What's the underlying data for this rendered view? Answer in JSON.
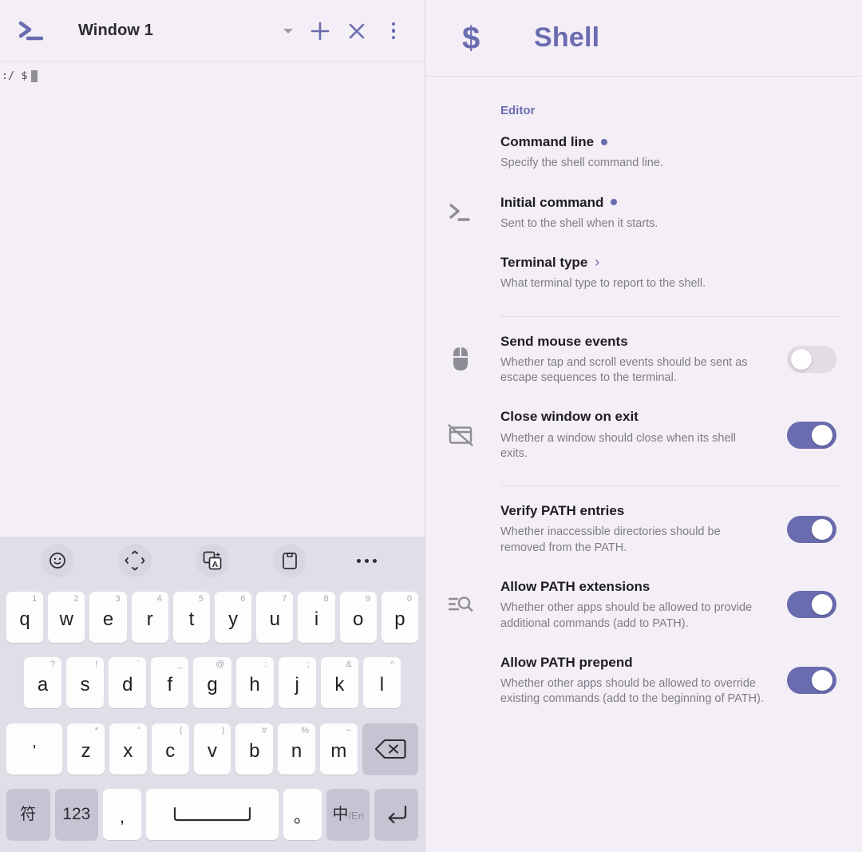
{
  "terminal": {
    "window_title": "Window 1",
    "logo_icon": "terminal-prompt-icon",
    "toolbar": {
      "dropdown_icon": "chevron-down-icon",
      "new_tab_icon": "plus-icon",
      "close_icon": "close-x-icon",
      "overflow_icon": "more-vertical-icon"
    },
    "prompt_line": ":/ $",
    "cursor": "block-cursor"
  },
  "keyboard": {
    "toolbar": [
      {
        "name": "emoji-icon",
        "glyph": "☺"
      },
      {
        "name": "cursor-move-icon",
        "glyph": "move"
      },
      {
        "name": "translate-icon",
        "glyph": "translate"
      },
      {
        "name": "clipboard-icon",
        "glyph": "clipboard"
      },
      {
        "name": "more-horizontal-icon",
        "glyph": "…"
      }
    ],
    "row1": [
      {
        "key": "q",
        "hint": "1"
      },
      {
        "key": "w",
        "hint": "2"
      },
      {
        "key": "e",
        "hint": "3"
      },
      {
        "key": "r",
        "hint": "4"
      },
      {
        "key": "t",
        "hint": "5"
      },
      {
        "key": "y",
        "hint": "6"
      },
      {
        "key": "u",
        "hint": "7"
      },
      {
        "key": "i",
        "hint": "8"
      },
      {
        "key": "o",
        "hint": "9"
      },
      {
        "key": "p",
        "hint": "0"
      }
    ],
    "row2": [
      {
        "key": "a",
        "hint": "?"
      },
      {
        "key": "s",
        "hint": "!"
      },
      {
        "key": "d",
        "hint": "`"
      },
      {
        "key": "f",
        "hint": "_"
      },
      {
        "key": "g",
        "hint": "@"
      },
      {
        "key": "h",
        "hint": ":"
      },
      {
        "key": "j",
        "hint": ";"
      },
      {
        "key": "k",
        "hint": "&"
      },
      {
        "key": "l",
        "hint": "^"
      }
    ],
    "row3": [
      {
        "key": "'",
        "hint": ""
      },
      {
        "key": "z",
        "hint": "*"
      },
      {
        "key": "x",
        "hint": "\""
      },
      {
        "key": "c",
        "hint": "("
      },
      {
        "key": "v",
        "hint": ")"
      },
      {
        "key": "b",
        "hint": "#"
      },
      {
        "key": "n",
        "hint": "%"
      },
      {
        "key": "m",
        "hint": "~"
      }
    ],
    "backspace_icon": "backspace-icon",
    "row4": {
      "symbols": "符",
      "numbers": "123",
      "comma": ",",
      "space": "space-bar",
      "period": "。",
      "lang_main": "中",
      "lang_sub": "/En",
      "enter_icon": "enter-return-icon"
    }
  },
  "settings": {
    "header_glyph": "$",
    "header_title": "Shell",
    "section_label": "Editor",
    "accent_color": "#6a6cb0",
    "items": [
      {
        "id": "command-line",
        "icon": "",
        "title": "Command line",
        "marker": "dot",
        "desc": "Specify the shell command line.",
        "control": "none"
      },
      {
        "id": "initial-command",
        "icon": "terminal-prompt-icon",
        "title": "Initial command",
        "marker": "dot",
        "desc": "Sent to the shell when it starts.",
        "control": "none"
      },
      {
        "id": "terminal-type",
        "icon": "",
        "title": "Terminal type",
        "marker": "chevron",
        "desc": "What terminal type to report to the shell.",
        "control": "none"
      },
      {
        "id": "send-mouse-events",
        "icon": "mouse-icon",
        "title": "Send mouse events",
        "marker": "",
        "desc": "Whether tap and scroll events should be sent as escape sequences to the terminal.",
        "control": "toggle",
        "value": false
      },
      {
        "id": "close-window-on-exit",
        "icon": "window-slash-icon",
        "title": "Close window on exit",
        "marker": "",
        "desc": "Whether a window should close when its shell exits.",
        "control": "toggle",
        "value": true
      },
      {
        "id": "verify-path-entries",
        "icon": "",
        "title": "Verify PATH entries",
        "marker": "",
        "desc": "Whether inaccessible directories should be removed from the PATH.",
        "control": "toggle",
        "value": true
      },
      {
        "id": "allow-path-extensions",
        "icon": "list-search-icon",
        "title": "Allow PATH extensions",
        "marker": "",
        "desc": "Whether other apps should be allowed to provide additional commands (add to PATH).",
        "control": "toggle",
        "value": true
      },
      {
        "id": "allow-path-prepend",
        "icon": "",
        "title": "Allow PATH prepend",
        "marker": "",
        "desc": "Whether other apps should be allowed to override existing commands (add to the beginning of PATH).",
        "control": "toggle",
        "value": true
      }
    ]
  }
}
